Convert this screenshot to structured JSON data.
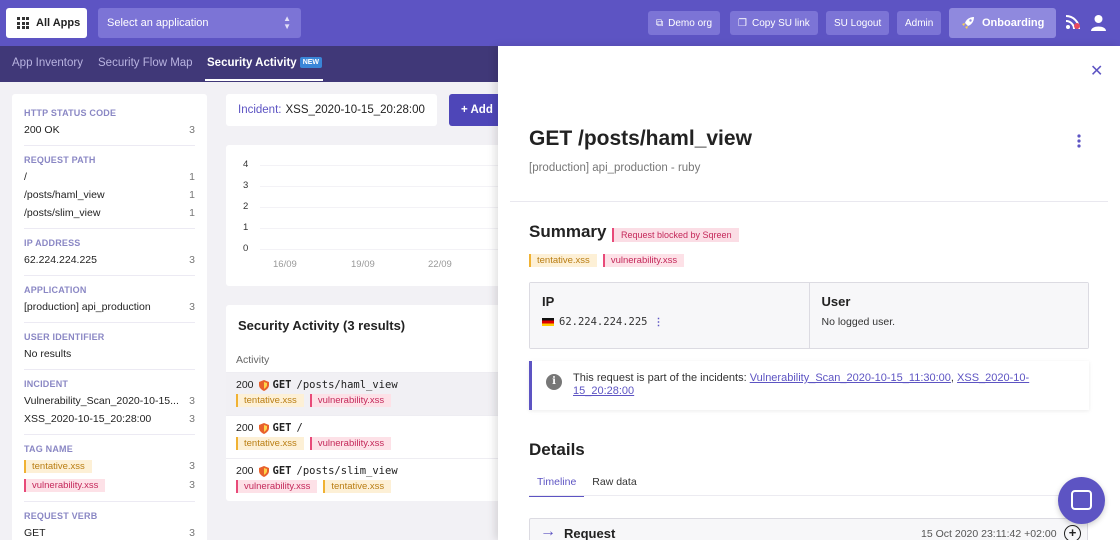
{
  "topbar": {
    "all_apps": "All Apps",
    "app_select": "Select an application",
    "buttons": {
      "demo_org": "Demo org",
      "copy_su": "Copy SU link",
      "su_logout": "SU Logout",
      "admin": "Admin",
      "onboarding": "Onboarding"
    },
    "color": "#5d54c3"
  },
  "subnav": {
    "tabs": [
      "App Inventory",
      "Security Flow Map",
      "Security Activity"
    ],
    "new_badge": "NEW"
  },
  "filters": {
    "http_status": {
      "heading": "HTTP STATUS CODE",
      "items": [
        {
          "label": "200 OK",
          "count": "3"
        }
      ]
    },
    "request_path": {
      "heading": "REQUEST PATH",
      "items": [
        {
          "label": "/",
          "count": "1"
        },
        {
          "label": "/posts/haml_view",
          "count": "1"
        },
        {
          "label": "/posts/slim_view",
          "count": "1"
        }
      ]
    },
    "ip": {
      "heading": "IP ADDRESS",
      "items": [
        {
          "label": "62.224.224.225",
          "count": "3"
        }
      ]
    },
    "application": {
      "heading": "APPLICATION",
      "items": [
        {
          "label": "[production] api_production",
          "count": "3"
        }
      ]
    },
    "user_identifier": {
      "heading": "USER IDENTIFIER",
      "empty": "No results"
    },
    "incident": {
      "heading": "INCIDENT",
      "items": [
        {
          "label": "Vulnerability_Scan_2020-10-15...",
          "count": "3"
        },
        {
          "label": "XSS_2020-10-15_20:28:00",
          "count": "3"
        }
      ]
    },
    "tag_name": {
      "heading": "TAG NAME",
      "items": [
        {
          "label": "tentative.xss",
          "count": "3"
        },
        {
          "label": "vulnerability.xss",
          "count": "3"
        }
      ]
    },
    "request_verb": {
      "heading": "REQUEST VERB",
      "items": [
        {
          "label": "GET",
          "count": "3"
        }
      ]
    }
  },
  "incident_filter": {
    "label": "Incident:",
    "value": "XSS_2020-10-15_20:28:00"
  },
  "add_button": "+ Add",
  "chart_data": {
    "type": "bar",
    "categories": [
      "16/09",
      "19/09",
      "22/09"
    ],
    "values": [
      0,
      0,
      0
    ],
    "y_ticks": [
      "4",
      "3",
      "2",
      "1",
      "0"
    ],
    "ylim": [
      0,
      4
    ]
  },
  "activity": {
    "title": "Security Activity (3 results)",
    "column": "Activity",
    "rows": [
      {
        "code": "200",
        "verb": "GET",
        "path": "/posts/haml_view",
        "tags": [
          "tentative.xss",
          "vulnerability.xss"
        ]
      },
      {
        "code": "200",
        "verb": "GET",
        "path": "/",
        "tags": [
          "tentative.xss",
          "vulnerability.xss"
        ]
      },
      {
        "code": "200",
        "verb": "GET",
        "path": "/posts/slim_view",
        "tags": [
          "vulnerability.xss",
          "tentative.xss"
        ]
      }
    ]
  },
  "detail": {
    "title": "GET /posts/haml_view",
    "subtitle": "[production] api_production - ruby",
    "summary_heading": "Summary",
    "blocked_badge": "Request blocked by Sqreen",
    "tags": [
      "tentative.xss",
      "vulnerability.xss"
    ],
    "ip_heading": "IP",
    "ip_value": "62.224.224.225",
    "user_heading": "User",
    "user_value": "No logged user.",
    "notice_text": "This request is part of the incidents: ",
    "incident_link_1": "Vulnerability_Scan_2020-10-15_11:30:00",
    "incident_link_2": "XSS_2020-10-15_20:28:00",
    "details_heading": "Details",
    "tabs": [
      "Timeline",
      "Raw data"
    ],
    "request_label": "Request",
    "request_time": "15 Oct 2020 23:11:42 +02:00"
  }
}
